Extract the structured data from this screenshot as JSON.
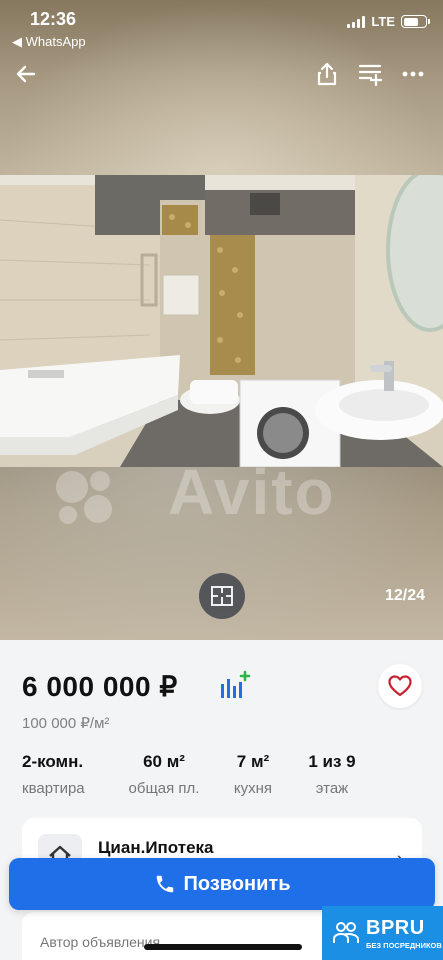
{
  "status_bar": {
    "time": "12:36",
    "back_app": "◀ WhatsApp",
    "network": "LTE"
  },
  "gallery": {
    "counter": "12/24",
    "watermark": "Avito"
  },
  "listing": {
    "price": "6 000 000 ₽",
    "price_per_m2": "100 000 ₽/м²",
    "params": [
      {
        "value": "2-комн.",
        "label": "квартира"
      },
      {
        "value": "60 м²",
        "label": "общая пл."
      },
      {
        "value": "7 м²",
        "label": "кухня"
      },
      {
        "value": "1 из 9",
        "label": "этаж"
      }
    ]
  },
  "agent": {
    "name": "Циан.Ипотека"
  },
  "author": {
    "label": "Автор объявления"
  },
  "actions": {
    "call_label": "Позвонить"
  },
  "badge": {
    "title": "BPRU",
    "subtitle": "БЕЗ ПОСРЕДНИКОВ"
  },
  "colors": {
    "primary": "#1f6fe8",
    "favorite": "#c8202f",
    "badge": "#1a8fe3"
  }
}
